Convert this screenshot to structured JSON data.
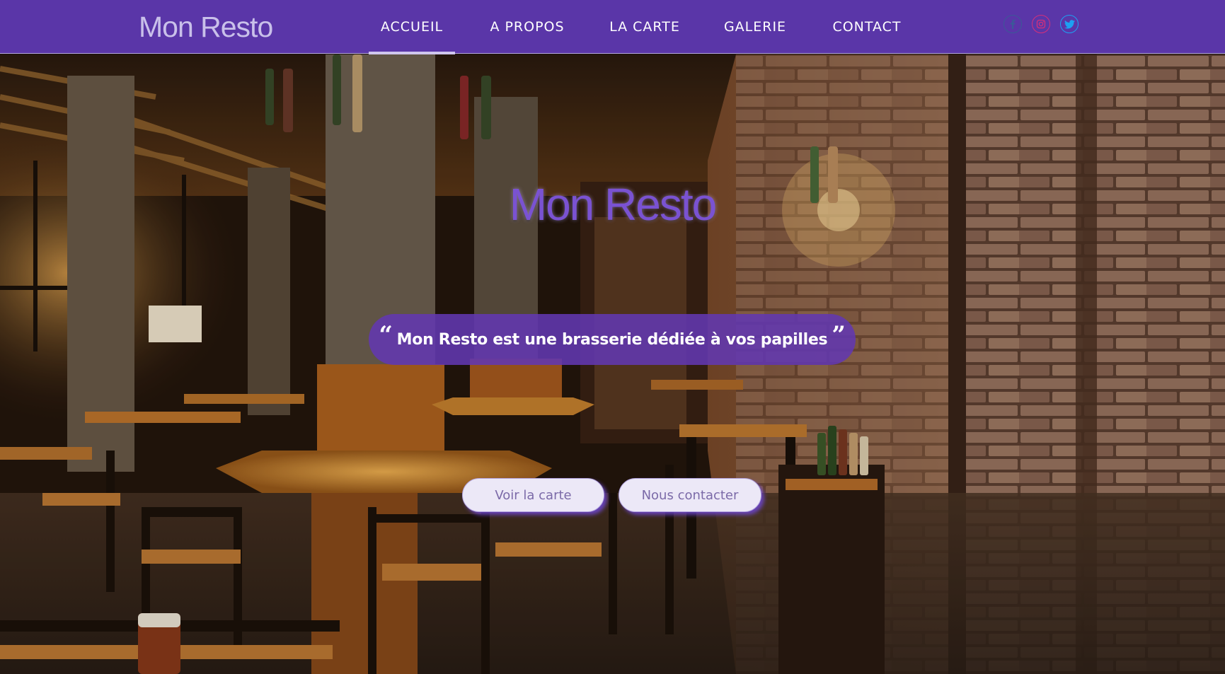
{
  "brand": "Mon Resto",
  "nav": {
    "items": [
      {
        "label": "ACCUEIL",
        "active": true
      },
      {
        "label": "A PROPOS",
        "active": false
      },
      {
        "label": "LA CARTE",
        "active": false
      },
      {
        "label": "GALERIE",
        "active": false
      },
      {
        "label": "CONTACT",
        "active": false
      }
    ]
  },
  "social": {
    "facebook": {
      "icon": "facebook-icon",
      "color": "#3b5998"
    },
    "instagram": {
      "icon": "instagram-icon",
      "color": "#d6307a"
    },
    "twitter": {
      "icon": "twitter-icon",
      "color": "#1da1f2"
    }
  },
  "hero": {
    "title": "Mon Resto",
    "tagline": "Mon Resto est une brasserie dédiée à vos papilles",
    "quote_open": "“",
    "quote_close": "”",
    "buttons": {
      "menu": "Voir la carte",
      "contact": "Nous contacter"
    }
  },
  "colors": {
    "navbar": "#5a36a8",
    "accent": "#7a52d2"
  }
}
